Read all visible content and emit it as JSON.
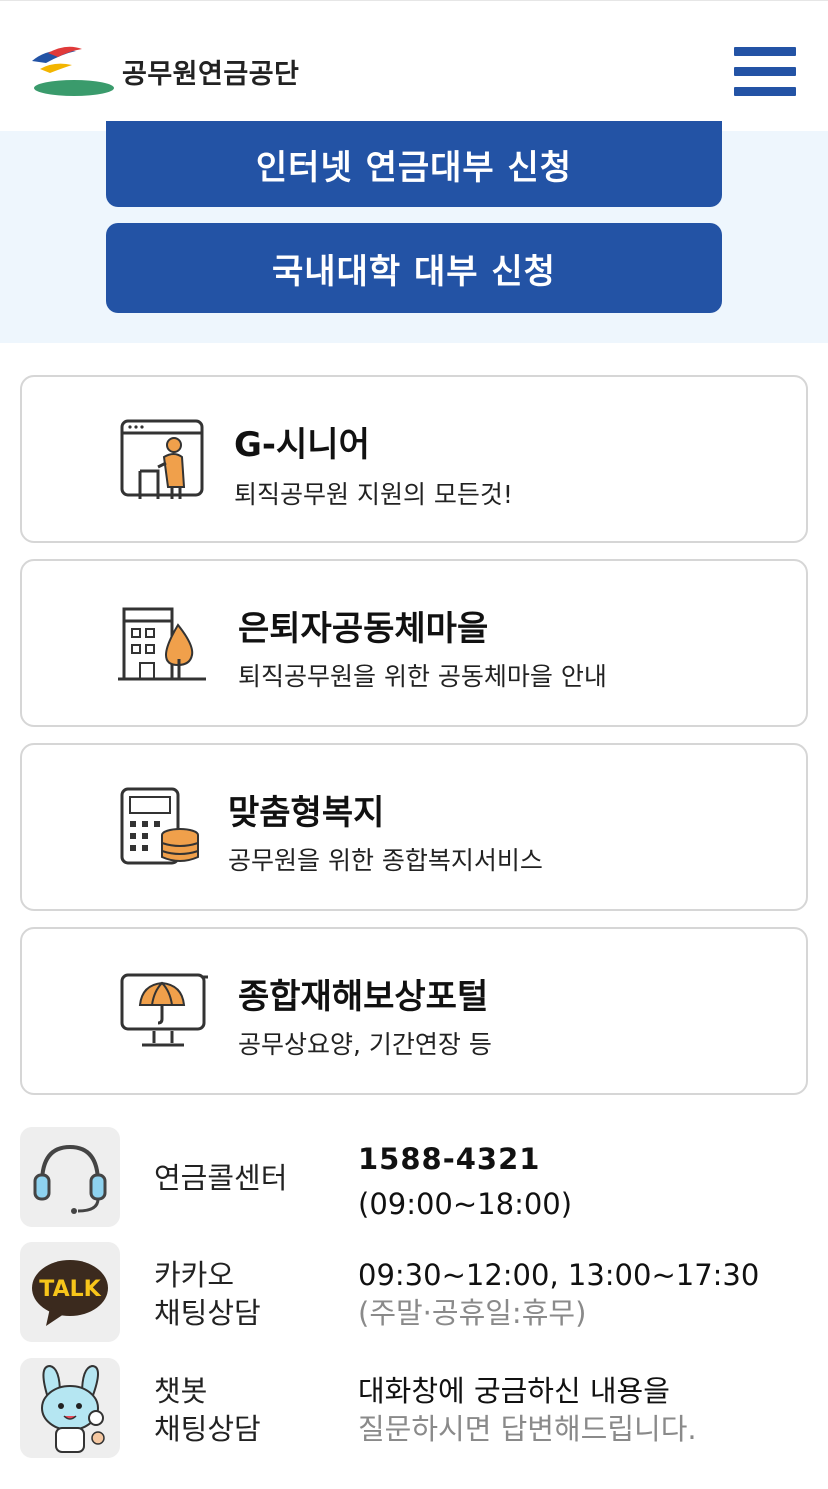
{
  "header": {
    "logo_text": "공무원연금공단",
    "menu_icon": "hamburger-menu-icon"
  },
  "banner": {
    "internet_loan_button": "인터넷 연금대부 신청",
    "university_loan_button": "국내대학 대부 신청"
  },
  "services": [
    {
      "title": "G-시니어",
      "subtitle": "퇴직공무원 지원의 모든것!",
      "icon": "senior-with-walker-icon"
    },
    {
      "title": "은퇴자공동체마을",
      "subtitle": "퇴직공무원을 위한 공동체마을 안내",
      "icon": "building-tree-icon"
    },
    {
      "title": "맞춤형복지",
      "subtitle": "공무원을 위한 종합복지서비스",
      "icon": "calculator-coins-icon"
    },
    {
      "title": "종합재해보상포털",
      "subtitle": "공무상요양, 기간연장 등",
      "icon": "monitor-umbrella-icon"
    }
  ],
  "contacts": {
    "callcenter": {
      "label": "연금콜센터",
      "phone": "1588-4321",
      "hours": "(09:00~18:00)",
      "icon": "headset-icon"
    },
    "kakao": {
      "label_line1": "카카오",
      "label_line2": "채팅상담",
      "hours": "09:30~12:00, 13:00~17:30",
      "note": "(주말·공휴일:휴무)",
      "icon": "kakao-talk-icon",
      "icon_text": "TALK"
    },
    "chatbot": {
      "label_line1": "챗봇",
      "label_line2": "채팅상담",
      "line1": "대화창에 궁금하신 내용을",
      "line2": "질문하시면 답변해드립니다.",
      "icon": "chatbot-mascot-icon"
    }
  },
  "colors": {
    "primary": "#2353a5",
    "banner_bg": "#eef6fd",
    "accent_orange": "#f0a04b",
    "card_border": "#d6d6d6"
  }
}
